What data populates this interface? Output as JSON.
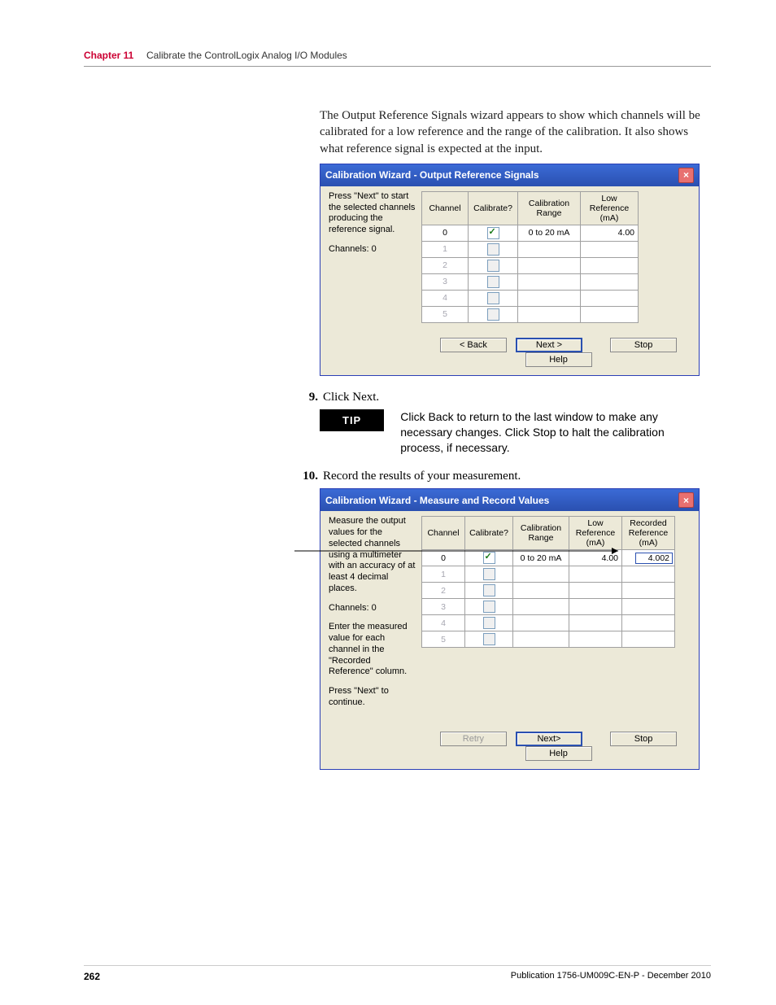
{
  "header": {
    "chapter_label": "Chapter 11",
    "chapter_title": "Calibrate the ControlLogix Analog I/O Modules"
  },
  "intro_paragraph": "The Output Reference Signals wizard appears to show which channels will be calibrated for a low reference and the range of the calibration. It also shows what reference signal is expected at the input.",
  "dialog1": {
    "title": "Calibration Wizard - Output Reference Signals",
    "instruction1": "Press \"Next\" to start the selected channels producing the reference signal.",
    "channels_label": "Channels: 0",
    "headers": {
      "channel": "Channel",
      "calibrate": "Calibrate?",
      "range": "Calibration Range",
      "lowref": "Low Reference (mA)"
    },
    "rows": [
      {
        "ch": "0",
        "checked": true,
        "range": "0 to 20 mA",
        "low": "4.00"
      },
      {
        "ch": "1",
        "checked": false,
        "range": "",
        "low": ""
      },
      {
        "ch": "2",
        "checked": false,
        "range": "",
        "low": ""
      },
      {
        "ch": "3",
        "checked": false,
        "range": "",
        "low": ""
      },
      {
        "ch": "4",
        "checked": false,
        "range": "",
        "low": ""
      },
      {
        "ch": "5",
        "checked": false,
        "range": "",
        "low": ""
      }
    ],
    "buttons": {
      "back": "< Back",
      "next": "Next >",
      "stop": "Stop",
      "help": "Help"
    }
  },
  "step9": {
    "num": "9.",
    "text": "Click Next."
  },
  "tip": {
    "label": "TIP",
    "text": "Click Back to return to the last window to make any necessary changes. Click Stop to halt the calibration process, if necessary."
  },
  "step10": {
    "num": "10.",
    "text": "Record the results of your measurement."
  },
  "dialog2": {
    "title": "Calibration Wizard - Measure and Record Values",
    "instruction1": "Measure the output values for the selected channels using a multimeter with an accuracy of at least 4 decimal places.",
    "channels_label": "Channels: 0",
    "instruction2": "Enter the measured value for each channel in the \"Recorded Reference\" column.",
    "instruction3": "Press \"Next\" to continue.",
    "headers": {
      "channel": "Channel",
      "calibrate": "Calibrate?",
      "range": "Calibration Range",
      "lowref": "Low Reference (mA)",
      "recref": "Recorded Reference (mA)"
    },
    "rows": [
      {
        "ch": "0",
        "checked": true,
        "range": "0 to 20 mA",
        "low": "4.00",
        "rec": "4.002"
      },
      {
        "ch": "1",
        "checked": false,
        "range": "",
        "low": "",
        "rec": ""
      },
      {
        "ch": "2",
        "checked": false,
        "range": "",
        "low": "",
        "rec": ""
      },
      {
        "ch": "3",
        "checked": false,
        "range": "",
        "low": "",
        "rec": ""
      },
      {
        "ch": "4",
        "checked": false,
        "range": "",
        "low": "",
        "rec": ""
      },
      {
        "ch": "5",
        "checked": false,
        "range": "",
        "low": "",
        "rec": ""
      }
    ],
    "buttons": {
      "retry": "Retry",
      "next": "Next>",
      "stop": "Stop",
      "help": "Help"
    }
  },
  "footer": {
    "page": "262",
    "pub": "Publication 1756-UM009C-EN-P - December 2010"
  }
}
